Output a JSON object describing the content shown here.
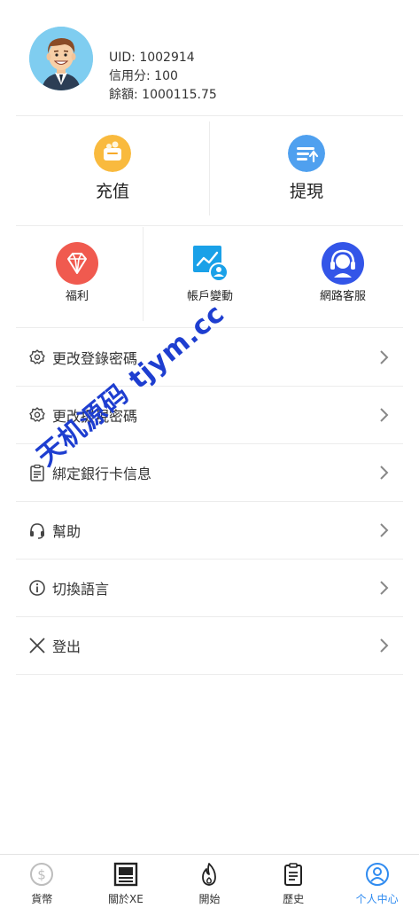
{
  "profile": {
    "uid": "UID: 1002914",
    "credit": "信用分: 100",
    "balance": "餘額: 1000115.75"
  },
  "primary_actions": [
    {
      "label": "充值",
      "icon": "wallet-icon"
    },
    {
      "label": "提現",
      "icon": "withdraw-icon"
    }
  ],
  "secondary_actions": [
    {
      "label": "福利",
      "icon": "diamond-icon"
    },
    {
      "label": "帳戶變動",
      "icon": "account-chart-icon"
    },
    {
      "label": "網路客服",
      "icon": "headset-icon"
    }
  ],
  "menu": [
    {
      "label": "更改登錄密碼",
      "icon": "gear-icon"
    },
    {
      "label": "更改提現密碼",
      "icon": "gear-icon"
    },
    {
      "label": "綁定銀行卡信息",
      "icon": "clipboard-icon"
    },
    {
      "label": "幫助",
      "icon": "headphones-icon"
    },
    {
      "label": "切換語言",
      "icon": "info-icon"
    },
    {
      "label": "登出",
      "icon": "close-icon"
    }
  ],
  "watermark": "天机源码 tjym.cc",
  "tabs": [
    {
      "label": "貨幣",
      "icon": "dollar-icon",
      "active": false
    },
    {
      "label": "關於XE",
      "icon": "news-icon",
      "active": false
    },
    {
      "label": "開始",
      "icon": "flame-icon",
      "active": false
    },
    {
      "label": "歷史",
      "icon": "clipboard-icon",
      "active": false
    },
    {
      "label": "个人中心",
      "icon": "user-icon",
      "active": true
    }
  ],
  "colors": {
    "accent": "#2f8bf0",
    "wallet": "#f7b733",
    "withdraw": "#4a9ef0",
    "diamond": "#f05a4f",
    "account": "#1aa1e8",
    "headset": "#3355e8"
  }
}
